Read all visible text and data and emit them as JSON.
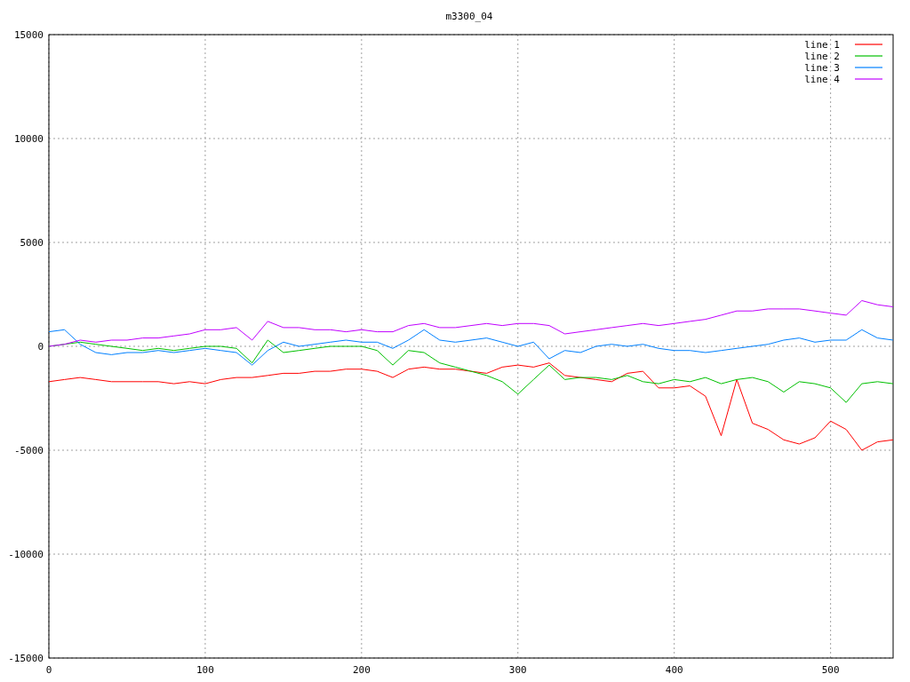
{
  "chart_data": {
    "type": "line",
    "title": "m3300_04",
    "x": [
      0,
      10,
      20,
      30,
      40,
      50,
      60,
      70,
      80,
      90,
      100,
      110,
      120,
      130,
      140,
      150,
      160,
      170,
      180,
      190,
      200,
      210,
      220,
      230,
      240,
      250,
      260,
      270,
      280,
      290,
      300,
      310,
      320,
      330,
      340,
      350,
      360,
      370,
      380,
      390,
      400,
      410,
      420,
      430,
      440,
      450,
      460,
      470,
      480,
      490,
      500,
      510,
      520,
      530,
      540
    ],
    "series": [
      {
        "name": "line 1",
        "color": "#ff0000",
        "values": [
          -1700,
          -1600,
          -1500,
          -1600,
          -1700,
          -1700,
          -1700,
          -1700,
          -1800,
          -1700,
          -1800,
          -1600,
          -1500,
          -1500,
          -1400,
          -1300,
          -1300,
          -1200,
          -1200,
          -1100,
          -1100,
          -1200,
          -1500,
          -1100,
          -1000,
          -1100,
          -1100,
          -1200,
          -1300,
          -1000,
          -900,
          -1000,
          -800,
          -1400,
          -1500,
          -1600,
          -1700,
          -1300,
          -1200,
          -2000,
          -2000,
          -1900,
          -2400,
          -4300,
          -1600,
          -3700,
          -4000,
          -4500,
          -4700,
          -4400,
          -3600,
          -4000,
          -5000,
          -4600,
          -4500
        ]
      },
      {
        "name": "line 2",
        "color": "#00c000",
        "values": [
          0,
          100,
          200,
          100,
          0,
          -100,
          -200,
          -100,
          -200,
          -100,
          0,
          0,
          -100,
          -800,
          300,
          -300,
          -200,
          -100,
          0,
          0,
          0,
          -200,
          -900,
          -200,
          -300,
          -800,
          -1000,
          -1200,
          -1400,
          -1700,
          -2300,
          -1600,
          -900,
          -1600,
          -1500,
          -1500,
          -1600,
          -1400,
          -1700,
          -1800,
          -1600,
          -1700,
          -1500,
          -1800,
          -1600,
          -1500,
          -1700,
          -2200,
          -1700,
          -1800,
          -2000,
          -2700,
          -1800,
          -1700,
          -1800
        ]
      },
      {
        "name": "line 3",
        "color": "#0080ff",
        "values": [
          700,
          800,
          100,
          -300,
          -400,
          -300,
          -300,
          -200,
          -300,
          -200,
          -100,
          -200,
          -300,
          -900,
          -200,
          200,
          0,
          100,
          200,
          300,
          200,
          200,
          -100,
          300,
          800,
          300,
          200,
          300,
          400,
          200,
          0,
          200,
          -600,
          -200,
          -300,
          0,
          100,
          0,
          100,
          -100,
          -200,
          -200,
          -300,
          -200,
          -100,
          0,
          100,
          300,
          400,
          200,
          300,
          300,
          800,
          400,
          300
        ]
      },
      {
        "name": "line 4",
        "color": "#c000ff",
        "values": [
          0,
          100,
          300,
          200,
          300,
          300,
          400,
          400,
          500,
          600,
          800,
          800,
          900,
          300,
          1200,
          900,
          900,
          800,
          800,
          700,
          800,
          700,
          700,
          1000,
          1100,
          900,
          900,
          1000,
          1100,
          1000,
          1100,
          1100,
          1000,
          600,
          700,
          800,
          900,
          1000,
          1100,
          1000,
          1100,
          1200,
          1300,
          1500,
          1700,
          1700,
          1800,
          1800,
          1800,
          1700,
          1600,
          1500,
          2200,
          2000,
          1900
        ]
      }
    ],
    "xlim": [
      0,
      540
    ],
    "ylim": [
      -15000,
      15000
    ],
    "xticks": [
      0,
      100,
      200,
      300,
      400,
      500
    ],
    "yticks": [
      -15000,
      -10000,
      -5000,
      0,
      5000,
      10000,
      15000
    ],
    "grid": true,
    "legend": true
  }
}
